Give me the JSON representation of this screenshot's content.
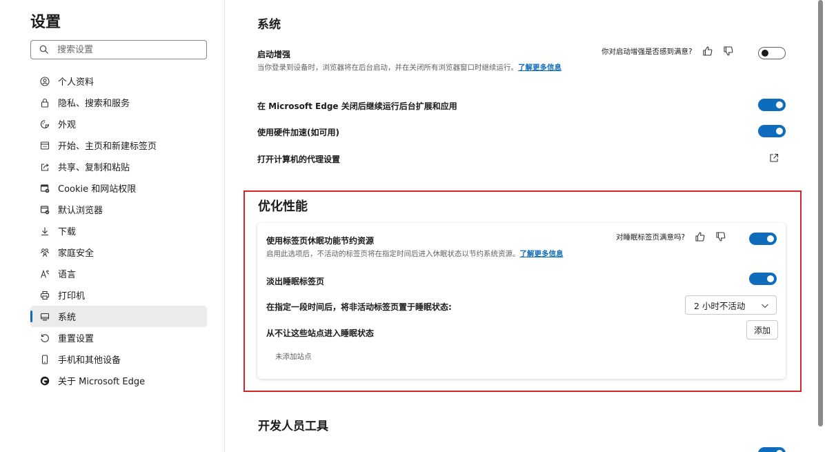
{
  "sidebar": {
    "title": "设置",
    "search": {
      "placeholder": "搜索设置",
      "value": ""
    },
    "items": [
      {
        "label": "个人资料",
        "icon": "profile-icon"
      },
      {
        "label": "隐私、搜索和服务",
        "icon": "lock-icon"
      },
      {
        "label": "外观",
        "icon": "appearance-icon"
      },
      {
        "label": "开始、主页和新建标签页",
        "icon": "start-page-icon"
      },
      {
        "label": "共享、复制和粘贴",
        "icon": "share-icon"
      },
      {
        "label": "Cookie 和网站权限",
        "icon": "site-permissions-icon"
      },
      {
        "label": "默认浏览器",
        "icon": "default-browser-icon"
      },
      {
        "label": "下载",
        "icon": "download-icon"
      },
      {
        "label": "家庭安全",
        "icon": "family-icon"
      },
      {
        "label": "语言",
        "icon": "language-icon"
      },
      {
        "label": "打印机",
        "icon": "printer-icon"
      },
      {
        "label": "系统",
        "icon": "system-icon",
        "active": true
      },
      {
        "label": "重置设置",
        "icon": "reset-icon"
      },
      {
        "label": "手机和其他设备",
        "icon": "phone-icon"
      },
      {
        "label": "关于 Microsoft Edge",
        "icon": "edge-logo-icon"
      }
    ]
  },
  "system": {
    "heading": "系统",
    "startup_boost": {
      "title": "启动增强",
      "desc": "当你登录到设备时，浏览器将在后台启动，并在关闭所有浏览器窗口时继续运行。",
      "link": "了解更多信息",
      "feedback": "你对启动增强是否感到满意?",
      "toggle": "off"
    },
    "background_apps": {
      "title": "在 Microsoft Edge 关闭后继续运行后台扩展和应用",
      "toggle": "on"
    },
    "hardware_accel": {
      "title": "使用硬件加速(如可用)",
      "toggle": "on"
    },
    "proxy": {
      "title": "打开计算机的代理设置"
    }
  },
  "performance": {
    "heading": "优化性能",
    "sleeping_tabs": {
      "title": "使用标签页休眠功能节约资源",
      "desc": "启用此选项后，不活动的标签页将在指定时间后进入休眠状态以节约系统资源。",
      "link": "了解更多信息",
      "feedback": "对睡眠标签页满意吗?",
      "toggle": "on"
    },
    "fade_tabs": {
      "title": "淡出睡眠标签页",
      "toggle": "on"
    },
    "sleep_after": {
      "title": "在指定一段时间后，将非活动标签页置于睡眠状态:",
      "value": "2 小时不活动"
    },
    "never_sleep": {
      "title": "从不让这些站点进入睡眠状态",
      "add_label": "添加",
      "empty_text": "未添加站点"
    }
  },
  "developer": {
    "heading": "开发人员工具"
  }
}
